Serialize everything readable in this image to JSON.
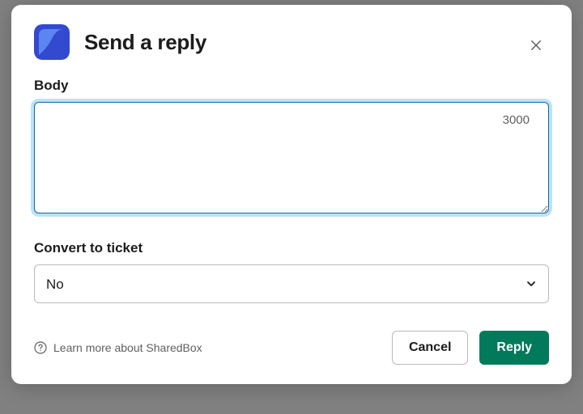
{
  "modal": {
    "title": "Send a reply",
    "app_icon": {
      "bg_color": "#3349cf",
      "fg_color": "#5b86f0"
    }
  },
  "body_field": {
    "label": "Body",
    "value": "",
    "char_limit": "3000"
  },
  "convert_field": {
    "label": "Convert to ticket",
    "selected": "No"
  },
  "footer": {
    "help_text": "Learn more about SharedBox",
    "cancel_label": "Cancel",
    "reply_label": "Reply"
  }
}
